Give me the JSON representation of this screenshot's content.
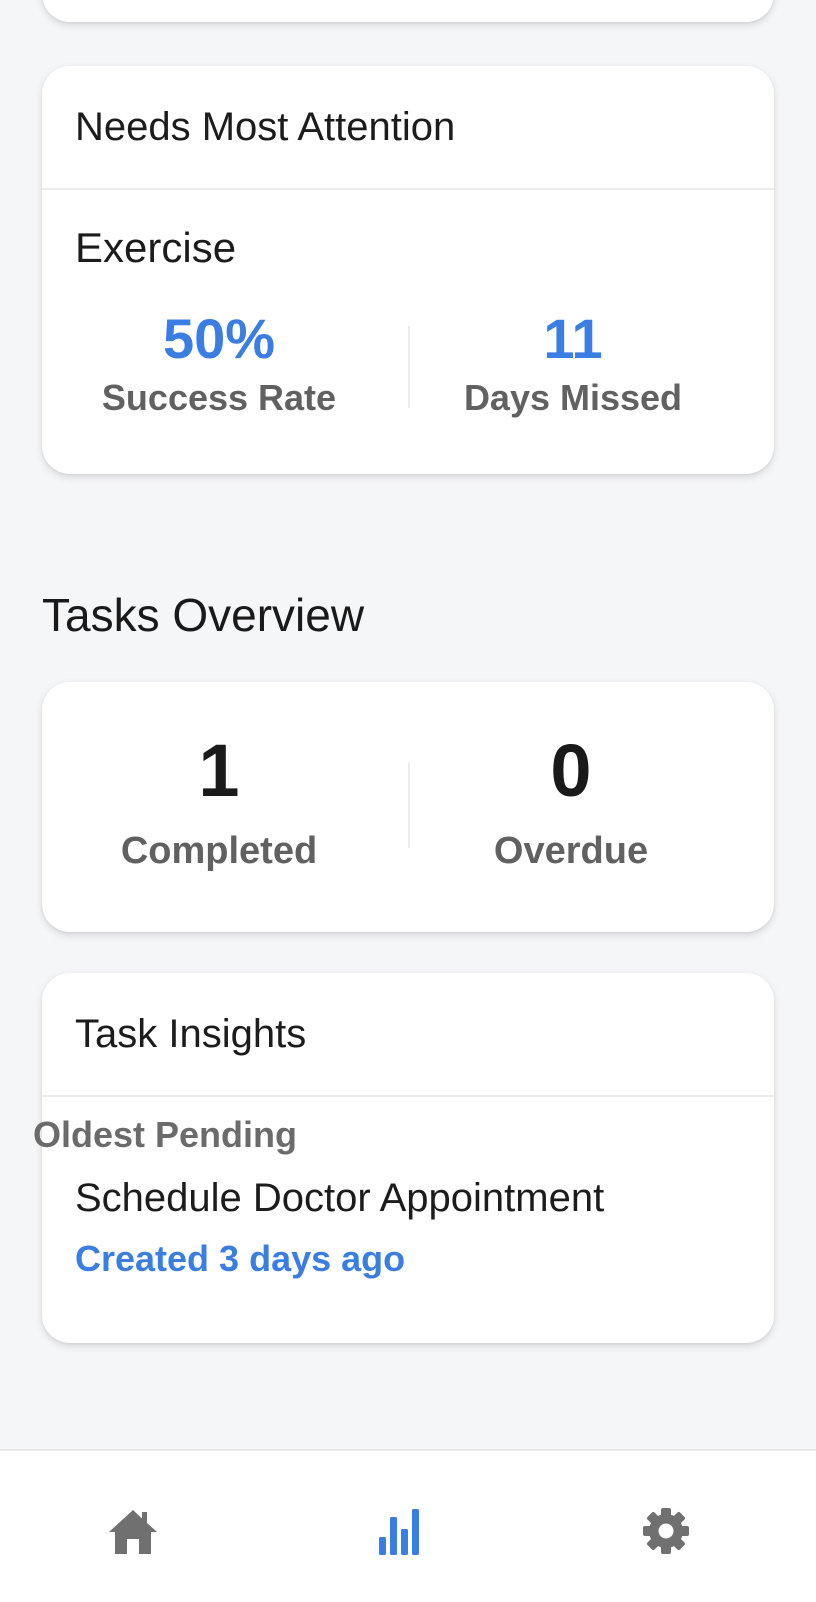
{
  "attention": {
    "title": "Needs Most Attention",
    "habit": "Exercise",
    "success_rate": {
      "value": "50%",
      "label": "Success Rate"
    },
    "days_missed": {
      "value": "11",
      "label": "Days Missed"
    }
  },
  "tasks_overview": {
    "title": "Tasks Overview",
    "completed": {
      "value": "1",
      "label": "Completed"
    },
    "overdue": {
      "value": "0",
      "label": "Overdue"
    }
  },
  "task_insights": {
    "title": "Task Insights",
    "oldest_label": "Oldest Pending",
    "task_name": "Schedule Doctor Appointment",
    "created": "Created 3 days ago"
  },
  "nav": {
    "items": [
      {
        "icon": "home-icon",
        "active": false
      },
      {
        "icon": "bar-chart-icon",
        "active": true
      },
      {
        "icon": "gear-icon",
        "active": false
      }
    ]
  },
  "colors": {
    "accent": "#3a7ee4",
    "inactive_icon": "#707070",
    "background": "#f5f6f8"
  }
}
